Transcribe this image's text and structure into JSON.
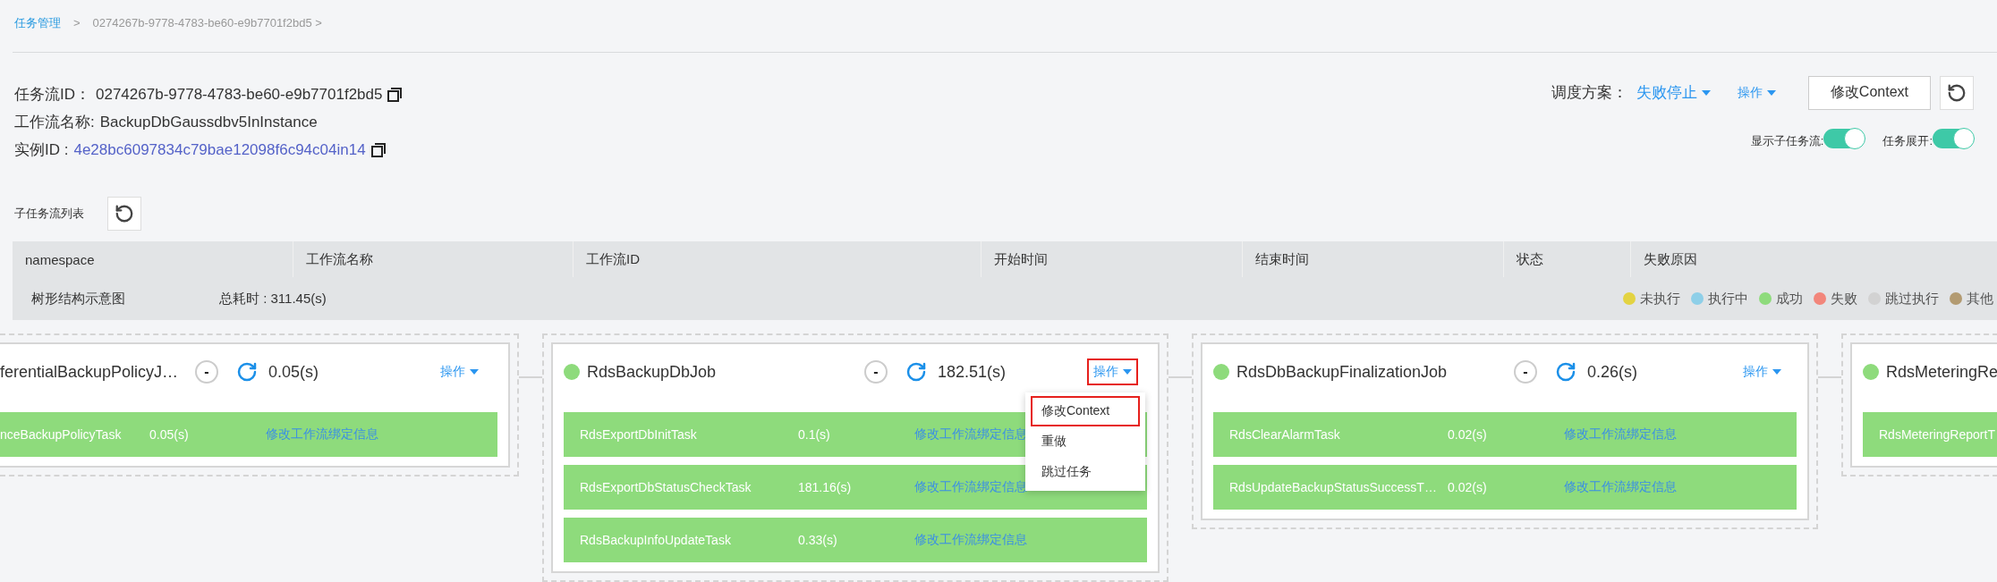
{
  "breadcrumb": [
    {
      "label": "任务管理",
      "link": true
    },
    {
      "label": "0274267b-9778-4783-be60-e9b7701f2bd5 >",
      "link": false
    }
  ],
  "breadcrumb_separator": ">",
  "info": [
    {
      "label": "任务流ID：",
      "value": "0274267b-9778-4783-be60-e9b7701f2bd5",
      "link": false,
      "copy": true
    },
    {
      "label": "工作流名称:",
      "value": "BackupDbGaussdbv5InInstance",
      "link": false,
      "copy": false
    },
    {
      "label": "实例ID :",
      "value": "4e28bc6097834c79bae12098f6c94c04in14",
      "link": true,
      "copy": true
    }
  ],
  "schedule": {
    "label": "调度方案：",
    "value": "失败停止"
  },
  "actions_label": "操作",
  "edit_context_button": "修改Context",
  "toggles": [
    {
      "label": "显示子任务流:",
      "on": true
    },
    {
      "label": "任务展开:",
      "on": true
    }
  ],
  "subflow_list": {
    "title": "子任务流列表"
  },
  "table": {
    "columns": [
      "namespace",
      "工作流名称",
      "工作流ID",
      "开始时间",
      "结束时间",
      "状态",
      "失败原因"
    ]
  },
  "tree": {
    "title": "树形结构示意图",
    "total_time": "总耗时 : 311.45(s)"
  },
  "legend": [
    {
      "label": "未执行",
      "color": "#e3d342"
    },
    {
      "label": "执行中",
      "color": "#8ecfe8"
    },
    {
      "label": "成功",
      "color": "#8edb7c"
    },
    {
      "label": "失败",
      "color": "#f2867b"
    },
    {
      "label": "跳过执行",
      "color": "#d2d2d2"
    },
    {
      "label": "其他",
      "color": "#b39b72"
    }
  ],
  "jobs": [
    {
      "name": "ferentialBackupPolicyJ…",
      "collapse": "-",
      "duration": "0.05(s)",
      "actions": "操作",
      "highlighted": false,
      "tasks": [
        {
          "name": "nceBackupPolicyTask",
          "duration": "0.05(s)",
          "link": "修改工作流绑定信息",
          "color": "#8edb7c"
        }
      ]
    },
    {
      "name": "RdsBackupDbJob",
      "color": "#8edb7c",
      "collapse": "-",
      "duration": "182.51(s)",
      "actions": "操作",
      "highlighted": true,
      "menu": [
        {
          "label": "修改Context",
          "highlighted": true
        },
        {
          "label": "重做",
          "highlighted": false
        },
        {
          "label": "跳过任务",
          "highlighted": false
        }
      ],
      "tasks": [
        {
          "name": "RdsExportDbInitTask",
          "duration": "0.1(s)",
          "link": "修改工作流绑定信息",
          "color": "#8edb7c"
        },
        {
          "name": "RdsExportDbStatusCheckTask",
          "duration": "181.16(s)",
          "link": "修改工作流绑定信息",
          "color": "#8edb7c"
        },
        {
          "name": "RdsBackupInfoUpdateTask",
          "duration": "0.33(s)",
          "link": "修改工作流绑定信息",
          "color": "#8edb7c"
        }
      ]
    },
    {
      "name": "RdsDbBackupFinalizationJob",
      "color": "#8edb7c",
      "collapse": "-",
      "duration": "0.26(s)",
      "actions": "操作",
      "highlighted": false,
      "tasks": [
        {
          "name": "RdsClearAlarmTask",
          "duration": "0.02(s)",
          "link": "修改工作流绑定信息",
          "color": "#8edb7c"
        },
        {
          "name": "RdsUpdateBackupStatusSuccessT…",
          "duration": "0.02(s)",
          "link": "修改工作流绑定信息",
          "color": "#8edb7c"
        }
      ]
    },
    {
      "name": "RdsMeteringRe",
      "color": "#8edb7c",
      "tasks": [
        {
          "name": "RdsMeteringReportT",
          "color": "#8edb7c"
        }
      ]
    }
  ]
}
